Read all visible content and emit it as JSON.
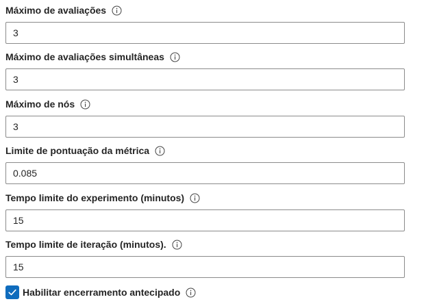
{
  "fields": [
    {
      "label": "Máximo de avaliações",
      "value": "3",
      "info_icon": "info-icon"
    },
    {
      "label": "Máximo de avaliações simultâneas",
      "value": "3",
      "info_icon": "info-icon"
    },
    {
      "label": "Máximo de nós",
      "value": "3",
      "info_icon": "info-icon"
    },
    {
      "label": "Limite de pontuação da métrica",
      "value": "0.085",
      "info_icon": "info-icon"
    },
    {
      "label": "Tempo limite do experimento (minutos)",
      "value": "15",
      "info_icon": "info-icon"
    },
    {
      "label": "Tempo limite de iteração (minutos).",
      "value": "15",
      "info_icon": "info-icon"
    }
  ],
  "early_termination": {
    "label": "Habilitar encerramento antecipado",
    "checked": true,
    "info_icon": "info-icon"
  },
  "colors": {
    "checkbox_accent": "#0f6cbd",
    "text": "#242424",
    "input_border": "#8a8a8a"
  }
}
